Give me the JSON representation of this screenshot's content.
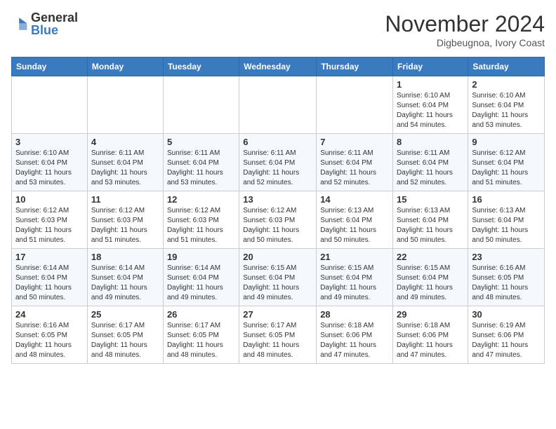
{
  "header": {
    "logo_general": "General",
    "logo_blue": "Blue",
    "month": "November 2024",
    "location": "Digbeugnoa, Ivory Coast"
  },
  "days_of_week": [
    "Sunday",
    "Monday",
    "Tuesday",
    "Wednesday",
    "Thursday",
    "Friday",
    "Saturday"
  ],
  "weeks": [
    [
      {
        "day": "",
        "info": ""
      },
      {
        "day": "",
        "info": ""
      },
      {
        "day": "",
        "info": ""
      },
      {
        "day": "",
        "info": ""
      },
      {
        "day": "",
        "info": ""
      },
      {
        "day": "1",
        "info": "Sunrise: 6:10 AM\nSunset: 6:04 PM\nDaylight: 11 hours\nand 54 minutes."
      },
      {
        "day": "2",
        "info": "Sunrise: 6:10 AM\nSunset: 6:04 PM\nDaylight: 11 hours\nand 53 minutes."
      }
    ],
    [
      {
        "day": "3",
        "info": "Sunrise: 6:10 AM\nSunset: 6:04 PM\nDaylight: 11 hours\nand 53 minutes."
      },
      {
        "day": "4",
        "info": "Sunrise: 6:11 AM\nSunset: 6:04 PM\nDaylight: 11 hours\nand 53 minutes."
      },
      {
        "day": "5",
        "info": "Sunrise: 6:11 AM\nSunset: 6:04 PM\nDaylight: 11 hours\nand 53 minutes."
      },
      {
        "day": "6",
        "info": "Sunrise: 6:11 AM\nSunset: 6:04 PM\nDaylight: 11 hours\nand 52 minutes."
      },
      {
        "day": "7",
        "info": "Sunrise: 6:11 AM\nSunset: 6:04 PM\nDaylight: 11 hours\nand 52 minutes."
      },
      {
        "day": "8",
        "info": "Sunrise: 6:11 AM\nSunset: 6:04 PM\nDaylight: 11 hours\nand 52 minutes."
      },
      {
        "day": "9",
        "info": "Sunrise: 6:12 AM\nSunset: 6:04 PM\nDaylight: 11 hours\nand 51 minutes."
      }
    ],
    [
      {
        "day": "10",
        "info": "Sunrise: 6:12 AM\nSunset: 6:03 PM\nDaylight: 11 hours\nand 51 minutes."
      },
      {
        "day": "11",
        "info": "Sunrise: 6:12 AM\nSunset: 6:03 PM\nDaylight: 11 hours\nand 51 minutes."
      },
      {
        "day": "12",
        "info": "Sunrise: 6:12 AM\nSunset: 6:03 PM\nDaylight: 11 hours\nand 51 minutes."
      },
      {
        "day": "13",
        "info": "Sunrise: 6:12 AM\nSunset: 6:03 PM\nDaylight: 11 hours\nand 50 minutes."
      },
      {
        "day": "14",
        "info": "Sunrise: 6:13 AM\nSunset: 6:04 PM\nDaylight: 11 hours\nand 50 minutes."
      },
      {
        "day": "15",
        "info": "Sunrise: 6:13 AM\nSunset: 6:04 PM\nDaylight: 11 hours\nand 50 minutes."
      },
      {
        "day": "16",
        "info": "Sunrise: 6:13 AM\nSunset: 6:04 PM\nDaylight: 11 hours\nand 50 minutes."
      }
    ],
    [
      {
        "day": "17",
        "info": "Sunrise: 6:14 AM\nSunset: 6:04 PM\nDaylight: 11 hours\nand 50 minutes."
      },
      {
        "day": "18",
        "info": "Sunrise: 6:14 AM\nSunset: 6:04 PM\nDaylight: 11 hours\nand 49 minutes."
      },
      {
        "day": "19",
        "info": "Sunrise: 6:14 AM\nSunset: 6:04 PM\nDaylight: 11 hours\nand 49 minutes."
      },
      {
        "day": "20",
        "info": "Sunrise: 6:15 AM\nSunset: 6:04 PM\nDaylight: 11 hours\nand 49 minutes."
      },
      {
        "day": "21",
        "info": "Sunrise: 6:15 AM\nSunset: 6:04 PM\nDaylight: 11 hours\nand 49 minutes."
      },
      {
        "day": "22",
        "info": "Sunrise: 6:15 AM\nSunset: 6:04 PM\nDaylight: 11 hours\nand 49 minutes."
      },
      {
        "day": "23",
        "info": "Sunrise: 6:16 AM\nSunset: 6:05 PM\nDaylight: 11 hours\nand 48 minutes."
      }
    ],
    [
      {
        "day": "24",
        "info": "Sunrise: 6:16 AM\nSunset: 6:05 PM\nDaylight: 11 hours\nand 48 minutes."
      },
      {
        "day": "25",
        "info": "Sunrise: 6:17 AM\nSunset: 6:05 PM\nDaylight: 11 hours\nand 48 minutes."
      },
      {
        "day": "26",
        "info": "Sunrise: 6:17 AM\nSunset: 6:05 PM\nDaylight: 11 hours\nand 48 minutes."
      },
      {
        "day": "27",
        "info": "Sunrise: 6:17 AM\nSunset: 6:05 PM\nDaylight: 11 hours\nand 48 minutes."
      },
      {
        "day": "28",
        "info": "Sunrise: 6:18 AM\nSunset: 6:06 PM\nDaylight: 11 hours\nand 47 minutes."
      },
      {
        "day": "29",
        "info": "Sunrise: 6:18 AM\nSunset: 6:06 PM\nDaylight: 11 hours\nand 47 minutes."
      },
      {
        "day": "30",
        "info": "Sunrise: 6:19 AM\nSunset: 6:06 PM\nDaylight: 11 hours\nand 47 minutes."
      }
    ]
  ]
}
